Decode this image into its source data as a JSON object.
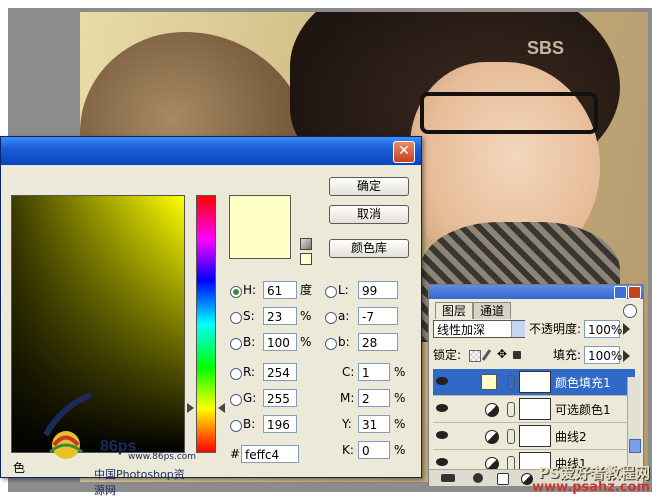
{
  "photo": {
    "channel_logo": "SBS"
  },
  "color_picker": {
    "close_glyph": "✕",
    "buttons": {
      "ok": "确定",
      "cancel": "取消",
      "libraries": "颜色库"
    },
    "hsb": {
      "h_label": "H:",
      "h_value": "61",
      "h_unit": "度",
      "s_label": "S:",
      "s_value": "23",
      "s_unit": "%",
      "b_label": "B:",
      "b_value": "100",
      "b_unit": "%"
    },
    "lab": {
      "l_label": "L:",
      "l_value": "99",
      "a_label": "a:",
      "a_value": "-7",
      "b_label": "b:",
      "b_value": "28"
    },
    "rgb": {
      "r_label": "R:",
      "r_value": "254",
      "g_label": "G:",
      "g_value": "255",
      "b_label": "B:",
      "b_value": "196"
    },
    "cmyk": {
      "c_label": "C:",
      "c_value": "1",
      "m_label": "M:",
      "m_value": "2",
      "y_label": "Y:",
      "y_value": "31",
      "k_label": "K:",
      "k_value": "0",
      "unit": "%"
    },
    "hex_label": "#",
    "hex_value": "feffc4",
    "current_color": "#feffc4",
    "field_left_text": "色"
  },
  "watermark_86": {
    "brand": "86ps",
    "url": "www.86ps.com",
    "tagline": "中国Photoshop资源网"
  },
  "layers_panel": {
    "tabs": [
      "图层",
      "通道"
    ],
    "blend_mode": "线性加深",
    "opacity_label": "不透明度:",
    "opacity_value": "100%",
    "lock_label": "锁定:",
    "fill_label": "填充:",
    "fill_value": "100%",
    "layers": [
      {
        "name": "颜色填充1",
        "selected": true
      },
      {
        "name": "可选颜色1",
        "selected": false
      },
      {
        "name": "曲线2",
        "selected": false
      },
      {
        "name": "曲线1",
        "selected": false
      }
    ]
  },
  "site_watermark": {
    "title": "PS爱好者教程网",
    "url": "www.psahz.com"
  }
}
